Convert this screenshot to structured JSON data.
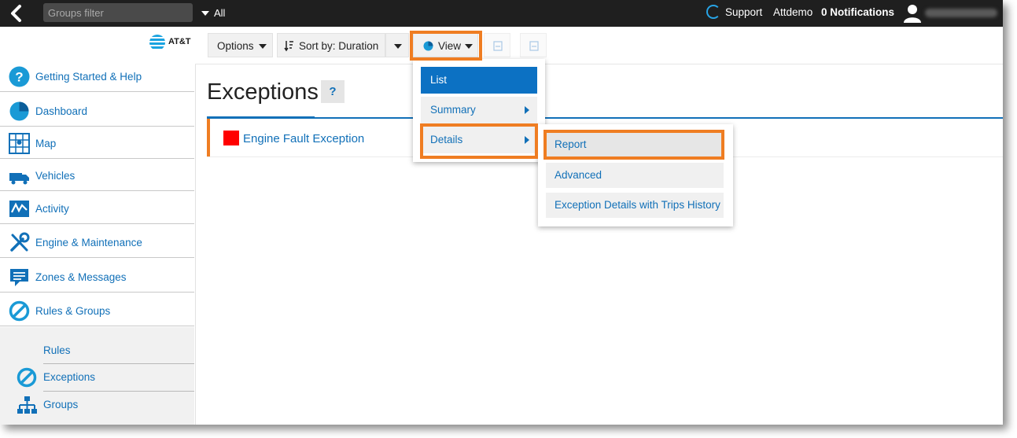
{
  "topbar": {
    "groups_filter_placeholder": "Groups filter",
    "groups_value": "All",
    "support": "Support",
    "account": "Attdemo",
    "notifications": "0 Notifications"
  },
  "brand": {
    "name": "AT&T"
  },
  "sidebar": {
    "items": [
      {
        "label": "Getting Started & Help",
        "icon": "help-icon"
      },
      {
        "label": "Dashboard",
        "icon": "pie-chart-icon"
      },
      {
        "label": "Map",
        "icon": "map-icon"
      },
      {
        "label": "Vehicles",
        "icon": "truck-icon"
      },
      {
        "label": "Activity",
        "icon": "activity-icon"
      },
      {
        "label": "Engine & Maintenance",
        "icon": "wrench-icon"
      },
      {
        "label": "Zones & Messages",
        "icon": "message-icon"
      },
      {
        "label": "Rules & Groups",
        "icon": "prohibit-icon"
      }
    ],
    "sub_items": [
      {
        "label": "Rules"
      },
      {
        "label": "Exceptions",
        "icon": "prohibit-icon"
      },
      {
        "label": "Groups",
        "icon": "hierarchy-icon"
      }
    ]
  },
  "toolbar": {
    "options": "Options",
    "sort": "Sort by: Duration",
    "view": "View"
  },
  "main": {
    "title": "Exceptions",
    "help": "?",
    "rows": [
      {
        "label": "Engine Fault Exception",
        "color": "#ff0000"
      }
    ]
  },
  "view_menu": {
    "items": [
      {
        "label": "List",
        "active": true
      },
      {
        "label": "Summary",
        "submenu": true
      },
      {
        "label": "Details",
        "submenu": true
      }
    ]
  },
  "details_submenu": {
    "items": [
      {
        "label": "Report"
      },
      {
        "label": "Advanced"
      },
      {
        "label": "Exception Details with Trips History"
      }
    ]
  },
  "colors": {
    "accent": "#1170b8",
    "highlight": "#ef7d22",
    "topbar": "#1f1f1f"
  }
}
